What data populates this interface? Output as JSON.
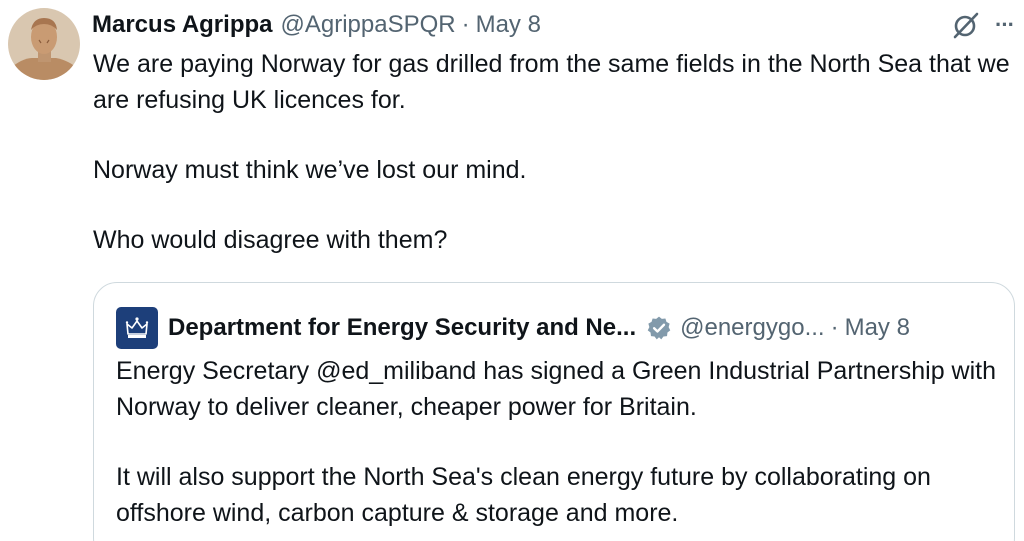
{
  "tweet": {
    "author_name": "Marcus Agrippa",
    "author_handle": "@AgrippaSPQR",
    "separator": "·",
    "date": "May 8",
    "avatar_icon": "bust-avatar",
    "grok_icon": "grok-icon",
    "more_icon": "more-options-icon",
    "more_label": "···",
    "paragraphs": [
      "We are paying Norway for gas drilled from the same fields in the North Sea that we are refusing UK licences for.",
      "Norway must think we’ve lost our mind.",
      "Who would disagree with them?"
    ]
  },
  "quote": {
    "author_name": "Department for Energy Security and Ne...",
    "author_handle": "@energygo...",
    "separator": "·",
    "date": "May 8",
    "avatar_icon": "crown-crest-icon",
    "verified_icon": "verified-badge-icon",
    "paragraphs": [
      "Energy Secretary @ed_miliband has signed a Green Industrial Partnership with Norway to deliver cleaner, cheaper power for Britain.",
      "It will also support the North Sea's clean energy future by collaborating on offshore wind, carbon capture & storage and more."
    ]
  },
  "colors": {
    "text": "#0f1419",
    "secondary": "#536471",
    "border": "#cfd9de",
    "crest_bg": "#1d3f7a",
    "verified_gray": "#829aab"
  }
}
